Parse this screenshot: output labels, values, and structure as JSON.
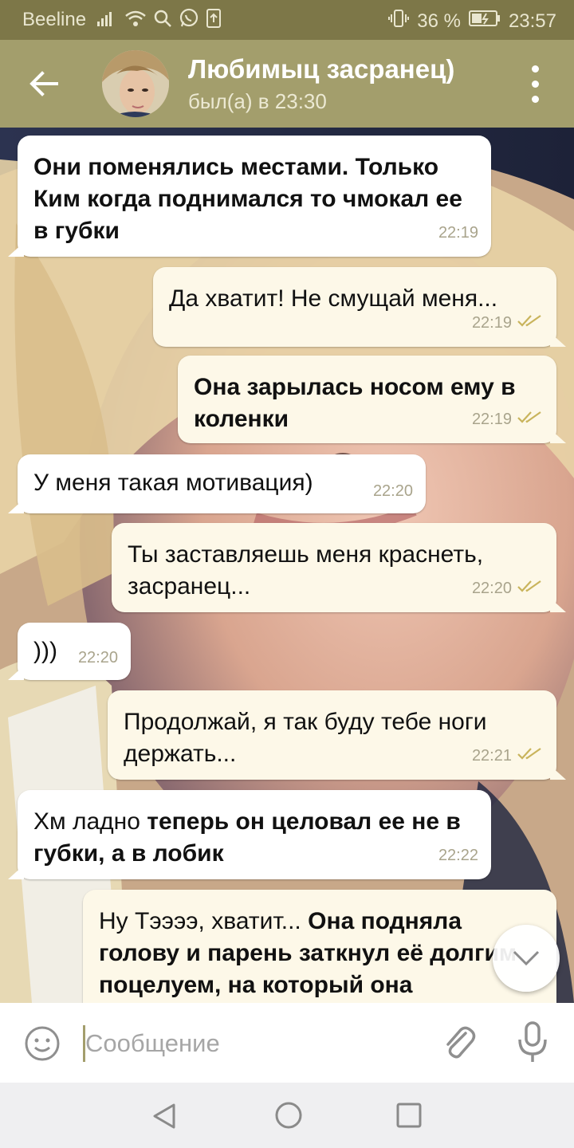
{
  "status_bar": {
    "carrier": "Beeline",
    "battery": "36 %",
    "time": "23:57",
    "icons": [
      "signal-icon",
      "wifi-icon",
      "search-icon",
      "whatsapp-icon",
      "upload-icon",
      "vibrate-icon",
      "battery-icon"
    ]
  },
  "header": {
    "title": "Любимыц засранец)",
    "status": "был(а) в 23:30",
    "colors": {
      "header": "#a39e6c",
      "status_bar": "#7d7748"
    }
  },
  "messages": [
    {
      "dir": "in",
      "parts": [
        {
          "text": "Они поменялись местами. Только Ким когда поднимался то чмокал ее в губки",
          "bold": true
        }
      ],
      "time": "22:19"
    },
    {
      "dir": "out",
      "parts": [
        {
          "text": "Да хватит! Не смущай меня...",
          "bold": false
        }
      ],
      "time": "22:19",
      "read": true
    },
    {
      "dir": "out",
      "parts": [
        {
          "text": "Она зарылась носом ему в коленки",
          "bold": true
        }
      ],
      "time": "22:19",
      "read": true
    },
    {
      "dir": "in",
      "parts": [
        {
          "text": "У меня такая мотивация)",
          "bold": false
        }
      ],
      "time": "22:20"
    },
    {
      "dir": "out",
      "parts": [
        {
          "text": "Ты заставляешь меня краснеть, засранец...",
          "bold": false
        }
      ],
      "time": "22:20",
      "read": true
    },
    {
      "dir": "in",
      "parts": [
        {
          "text": ")))",
          "bold": false
        }
      ],
      "time": "22:20"
    },
    {
      "dir": "out",
      "parts": [
        {
          "text": "Продолжай, я так буду тебе ноги держать...",
          "bold": false
        }
      ],
      "time": "22:21",
      "read": true
    },
    {
      "dir": "in",
      "parts": [
        {
          "text": "Хм ладно ",
          "bold": false
        },
        {
          "text": "теперь он целовал ее не в губки, а в лобик",
          "bold": true
        }
      ],
      "time": "22:22"
    },
    {
      "dir": "out",
      "parts": [
        {
          "text": "Ну Тээээ, хватит... ",
          "bold": false
        },
        {
          "text": "Она подняла голову и парень заткнул её долгим поцелуем, на который она",
          "bold": true
        }
      ],
      "time": ""
    }
  ],
  "input": {
    "placeholder": "Сообщение"
  }
}
